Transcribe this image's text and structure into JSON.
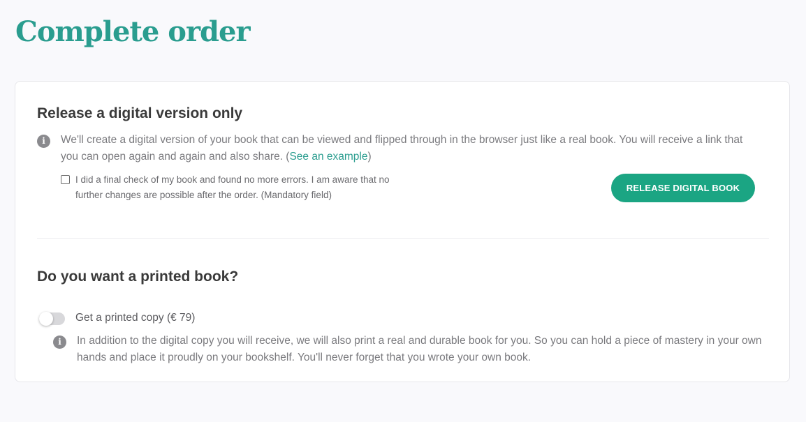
{
  "page": {
    "title": "Complete order"
  },
  "digital": {
    "title": "Release a digital version only",
    "info_icon": "info-icon",
    "description": "We'll create a digital version of your book that can be viewed and flipped through in the browser just like a real book. You will receive a link that you can open again and again and also share. (",
    "example_link": "See an example",
    "description_end": ")",
    "checkbox_checked": false,
    "checkbox_label": "I did a final check of my book and found no more errors. I am aware that no further changes are possible after the order. (Mandatory field)",
    "release_button": "RELEASE DIGITAL BOOK"
  },
  "print": {
    "title": "Do you want a printed book?",
    "toggle_on": false,
    "toggle_label": "Get a printed copy (€ 79)",
    "info_icon": "info-icon",
    "description": "In addition to the digital copy you will receive, we will also print a real and durable book for you. So you can hold a piece of mastery in your own hands and place it proudly on your bookshelf. You'll never forget that you wrote your own book."
  },
  "colors": {
    "brand": "#2a9d8f",
    "button": "#1ba583",
    "background": "#f9f9fc"
  }
}
